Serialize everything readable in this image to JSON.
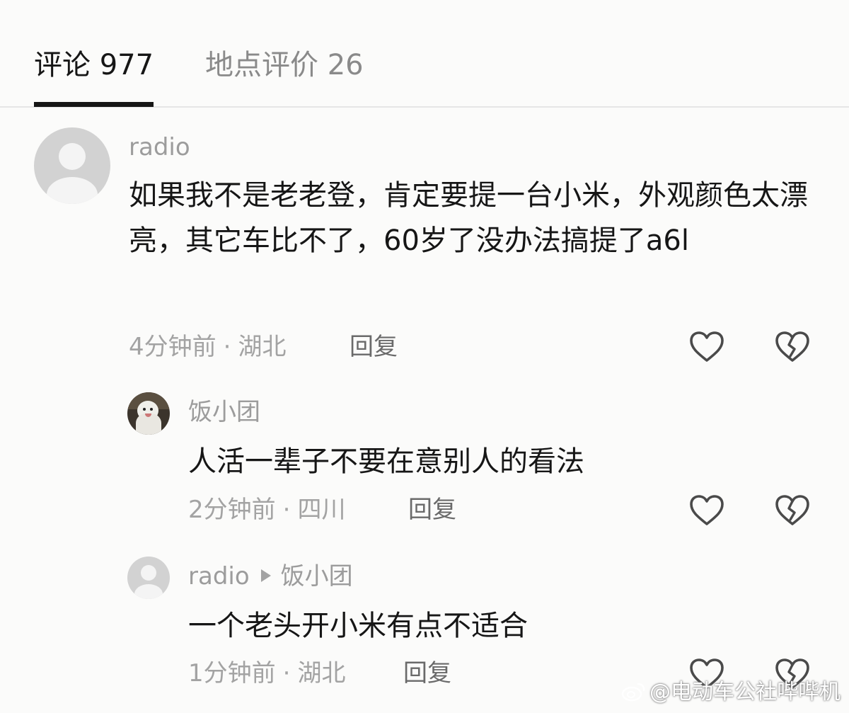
{
  "tabs": [
    {
      "label": "评论 977",
      "active": true
    },
    {
      "label": "地点评价 26",
      "active": false
    }
  ],
  "comments": [
    {
      "username": "radio",
      "text": "如果我不是老老登，肯定要提一台小米，外观颜色太漂亮，其它车比不了，60岁了没办法搞提了a6l",
      "time": "4分钟前",
      "location": "湖北",
      "reply_label": "回复",
      "avatar": "default-avatar-icon"
    },
    {
      "username": "饭小团",
      "text": "人活一辈子不要在意别人的看法",
      "time": "2分钟前",
      "location": "四川",
      "reply_label": "回复",
      "avatar": "dog-photo-avatar"
    },
    {
      "username": "radio",
      "reply_to": "饭小团",
      "text": "一个老头开小米有点不适合",
      "time": "1分钟前",
      "location": "湖北",
      "reply_label": "回复",
      "avatar": "default-avatar-icon"
    }
  ],
  "meta_separator": "·",
  "icons": {
    "like": "heart-outline-icon",
    "dislike": "broken-heart-icon",
    "reply_arrow": "play-arrow-icon"
  },
  "colors": {
    "background": "#fbfbfa",
    "text": "#161616",
    "muted": "#a3a3a3",
    "tab_inactive": "#8a8a8a"
  },
  "watermark": "@电动车公社哔哔机"
}
